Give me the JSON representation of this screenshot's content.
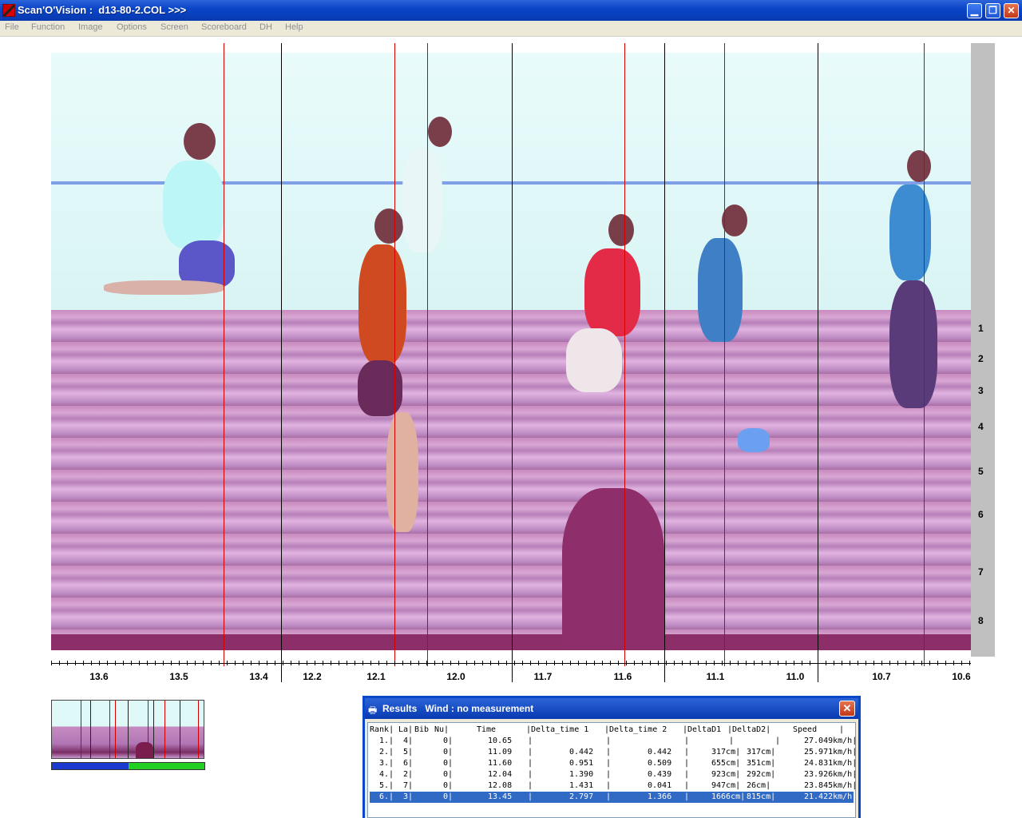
{
  "window": {
    "title": "Scan'O'Vision :  d13-80-2.COL >>>",
    "min_glyph": "▁",
    "max_glyph": "❐",
    "close_glyph": "✕"
  },
  "menu": [
    "File",
    "Function",
    "Image",
    "Options",
    "Screen",
    "Scoreboard",
    "DH",
    "Help"
  ],
  "lanes": [
    "1",
    "2",
    "3",
    "4",
    "5",
    "6",
    "7",
    "8"
  ],
  "scale_labels": [
    "13.6",
    "13.5",
    "13.4",
    "12.2",
    "12.1",
    "12.0",
    "11.7",
    "11.6",
    "11.1",
    "11.0",
    "10.7",
    "10.6"
  ],
  "results": {
    "title": "Results   Wind : no measurement",
    "icon": "printer-icon",
    "close_glyph": "✕",
    "header": [
      "Rank|",
      "La|",
      "Bib",
      " Nu|",
      "Time",
      "|Delta_time 1",
      "|Delta_time 2",
      "|DeltaD1",
      "|DeltaD2|",
      "Speed",
      "|"
    ],
    "rows": [
      [
        "1.|",
        "4|",
        "",
        "0|",
        "10.65",
        "|",
        "",
        "|",
        "",
        "|",
        "",
        "|",
        "",
        "|",
        "27.049km/h|"
      ],
      [
        "2.|",
        "5|",
        "",
        "0|",
        "11.09",
        "|",
        "0.442",
        "|",
        "0.442",
        "|",
        "317cm|",
        "",
        "317cm|",
        "",
        "25.971km/h|"
      ],
      [
        "3.|",
        "6|",
        "",
        "0|",
        "11.60",
        "|",
        "0.951",
        "|",
        "0.509",
        "|",
        "655cm|",
        "",
        "351cm|",
        "",
        "24.831km/h|"
      ],
      [
        "4.|",
        "2|",
        "",
        "0|",
        "12.04",
        "|",
        "1.390",
        "|",
        "0.439",
        "|",
        "923cm|",
        "",
        "292cm|",
        "",
        "23.926km/h|"
      ],
      [
        "5.|",
        "7|",
        "",
        "0|",
        "12.08",
        "|",
        "1.431",
        "|",
        "0.041",
        "|",
        "947cm|",
        "",
        "26cm|",
        "",
        "23.845km/h|"
      ],
      [
        "6.|",
        "3|",
        "",
        "0|",
        "13.45",
        "|",
        "2.797",
        "|",
        "1.366",
        "|",
        "1666cm|",
        "",
        "815cm|",
        "",
        "21.422km/h|"
      ]
    ],
    "selected_row": 5
  },
  "colors": {
    "titlebar": "#0a46c8",
    "red_line": "#d40000",
    "selection": "#316ac5"
  }
}
